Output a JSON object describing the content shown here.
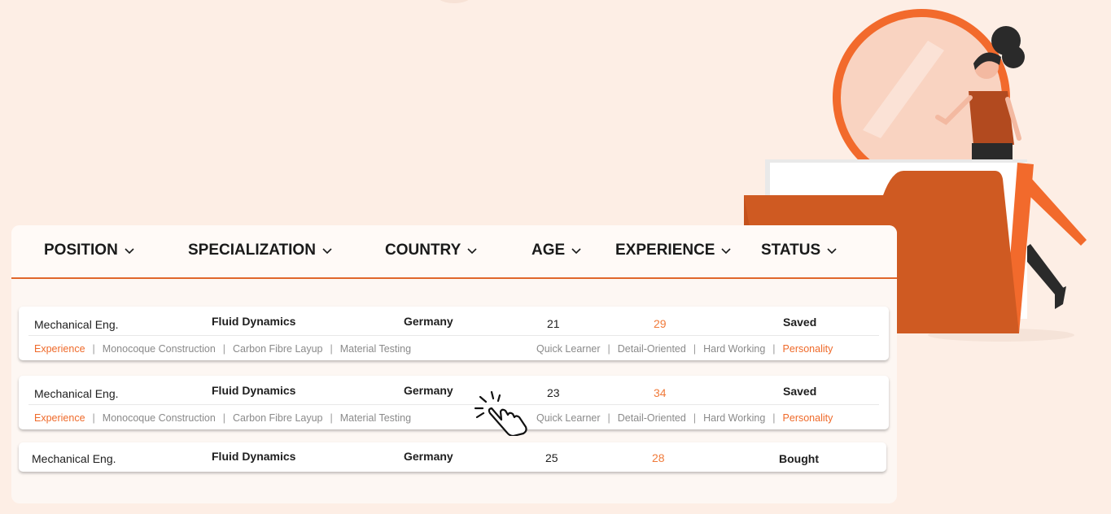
{
  "columns": [
    {
      "label": "POSITION",
      "icon": "chevron-down-icon"
    },
    {
      "label": "SPECIALIZATION",
      "icon": "chevron-down-icon"
    },
    {
      "label": "COUNTRY",
      "icon": "chevron-down-icon"
    },
    {
      "label": "AGE",
      "icon": "chevron-down-icon"
    },
    {
      "label": "EXPERIENCE",
      "icon": "chevron-down-icon"
    },
    {
      "label": "STATUS",
      "icon": "chevron-down-icon"
    }
  ],
  "rows": [
    {
      "position": "Mechanical Eng.",
      "specialization": "Fluid Dynamics",
      "country": "Germany",
      "age": "21",
      "experience": "29",
      "status": "Saved",
      "tags_left": [
        "Experience",
        "Monocoque Construction",
        "Carbon Fibre Layup",
        "Material Testing"
      ],
      "tags_right": [
        "Quick Learner",
        "Detail-Oriented",
        "Hard Working",
        "Personality"
      ]
    },
    {
      "position": "Mechanical Eng.",
      "specialization": "Fluid Dynamics",
      "country": "Germany",
      "age": "23",
      "experience": "34",
      "status": "Saved",
      "tags_left": [
        "Experience",
        "Monocoque Construction",
        "Carbon Fibre Layup",
        "Material Testing"
      ],
      "tags_right": [
        "Quick Learner",
        "Detail-Oriented",
        "Hard Working",
        "Personality"
      ]
    },
    {
      "position": "Mechanical Eng.",
      "specialization": "Fluid Dynamics",
      "country": "Germany",
      "age": "25",
      "experience": "28",
      "status": "Bought"
    }
  ],
  "colors": {
    "background": "#fdeee5",
    "accent": "#e0672c",
    "highlight_text": "#f07a3a",
    "folder": "#cf5a22"
  }
}
